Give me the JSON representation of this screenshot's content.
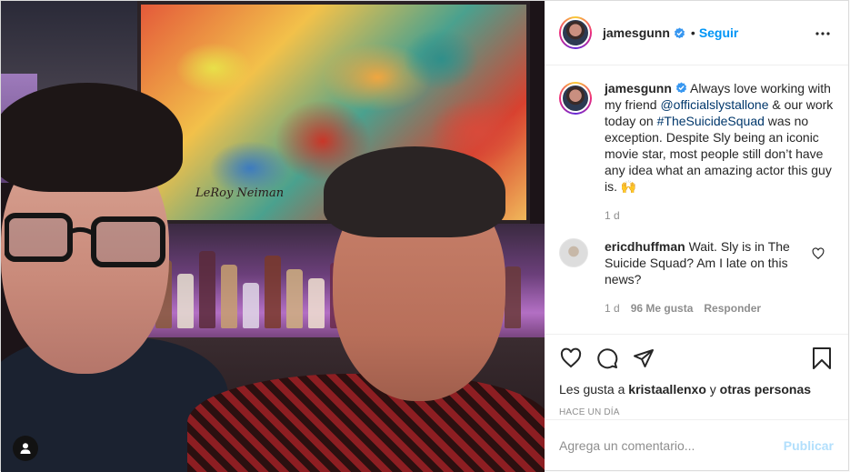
{
  "post": {
    "author": {
      "username": "jamesgunn",
      "verified": true,
      "follow_label": "Seguir",
      "separator": "•"
    },
    "caption": {
      "username": "jamesgunn",
      "text_before": "Always love working with my friend ",
      "mention": "@officialslystallone",
      "text_mid": " & our work today on ",
      "hashtag": "#TheSuicideSquad",
      "text_after": " was no exception. Despite Sly being an iconic movie star, most people still don’t have any idea what an amazing actor this guy is. 🙌",
      "age": "1 d"
    },
    "comments": [
      {
        "username": "ericdhuffman",
        "text": "Wait. Sly is in The Suicide Squad? Am I late on this news?",
        "age": "1 d",
        "likes": "96 Me gusta",
        "reply_label": "Responder"
      }
    ],
    "likes": {
      "prefix": "Les gusta a",
      "user": "kristaallenxo",
      "connector": "y",
      "others": "otras personas"
    },
    "timestamp": "Hace un día",
    "add_comment": {
      "placeholder": "Agrega un comentario...",
      "publish_label": "Publicar"
    },
    "photo": {
      "painting_signature": "LeRoy Neiman"
    }
  },
  "colors": {
    "accent": "#0095f6",
    "link": "#00376b",
    "muted": "#8e8e8e",
    "publish_disabled": "#b2dffc"
  },
  "icons": [
    "verified-badge-icon",
    "more-options-icon",
    "heart-icon",
    "comment-icon",
    "share-icon",
    "bookmark-icon",
    "user-tag-icon"
  ]
}
